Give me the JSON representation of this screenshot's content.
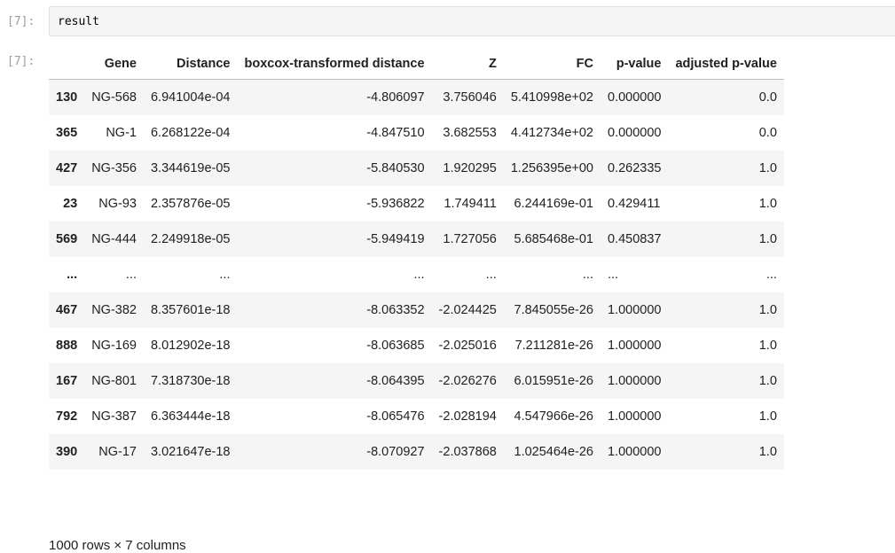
{
  "input_cell": {
    "prompt": "[7]:",
    "code": "result"
  },
  "output_cell": {
    "prompt": "[7]:",
    "table": {
      "columns": [
        "",
        "Gene",
        "Distance",
        "boxcox-transformed distance",
        "Z",
        "FC",
        "p-value",
        "adjusted p-value"
      ],
      "rows": [
        [
          "130",
          "NG-568",
          "6.941004e-04",
          "-4.806097",
          "3.756046",
          "5.410998e+02",
          "0.000000",
          "0.0"
        ],
        [
          "365",
          "NG-1",
          "6.268122e-04",
          "-4.847510",
          "3.682553",
          "4.412734e+02",
          "0.000000",
          "0.0"
        ],
        [
          "427",
          "NG-356",
          "3.344619e-05",
          "-5.840530",
          "1.920295",
          "1.256395e+00",
          "0.262335",
          "1.0"
        ],
        [
          "23",
          "NG-93",
          "2.357876e-05",
          "-5.936822",
          "1.749411",
          "6.244169e-01",
          "0.429411",
          "1.0"
        ],
        [
          "569",
          "NG-444",
          "2.249918e-05",
          "-5.949419",
          "1.727056",
          "5.685468e-01",
          "0.450837",
          "1.0"
        ],
        [
          "...",
          "...",
          "...",
          "...",
          "...",
          "...",
          "...",
          "..."
        ],
        [
          "467",
          "NG-382",
          "8.357601e-18",
          "-8.063352",
          "-2.024425",
          "7.845055e-26",
          "1.000000",
          "1.0"
        ],
        [
          "888",
          "NG-169",
          "8.012902e-18",
          "-8.063685",
          "-2.025016",
          "7.211281e-26",
          "1.000000",
          "1.0"
        ],
        [
          "167",
          "NG-801",
          "7.318730e-18",
          "-8.064395",
          "-2.026276",
          "6.015951e-26",
          "1.000000",
          "1.0"
        ],
        [
          "792",
          "NG-387",
          "6.363444e-18",
          "-8.065476",
          "-2.028194",
          "4.547966e-26",
          "1.000000",
          "1.0"
        ],
        [
          "390",
          "NG-17",
          "3.021647e-18",
          "-8.070927",
          "-2.037868",
          "1.025464e-26",
          "1.000000",
          "1.0"
        ]
      ]
    },
    "footer": "1000 rows × 7 columns"
  }
}
